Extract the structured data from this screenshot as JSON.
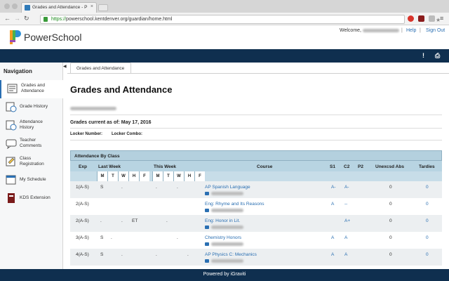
{
  "browser": {
    "tab_title": "Grades and Attendance - P",
    "tab_close": "×",
    "url_scheme": "https://",
    "url_rest": "powerschool.kentdenver.org/guardian/home.html",
    "star_icon": "★"
  },
  "header": {
    "logo_text": "PowerSchool",
    "welcome": "Welcome,",
    "separator": "|",
    "help": "Help",
    "sign_out": "Sign Out"
  },
  "sidebar": {
    "title": "Navigation",
    "items": [
      {
        "label1": "Grades and",
        "label2": "Attendance",
        "icon": "grades-icon"
      },
      {
        "label1": "Grade History",
        "label2": "",
        "icon": "grade-history-icon"
      },
      {
        "label1": "Attendance",
        "label2": "History",
        "icon": "attendance-history-icon"
      },
      {
        "label1": "Teacher",
        "label2": "Comments",
        "icon": "teacher-comments-icon"
      },
      {
        "label1": "Class",
        "label2": "Registration",
        "icon": "class-registration-icon"
      },
      {
        "label1": "My Schedule",
        "label2": "",
        "icon": "schedule-icon"
      },
      {
        "label1": "KDS Extension",
        "label2": "",
        "icon": "kds-extension-icon"
      }
    ]
  },
  "content": {
    "tab": "Grades and Attendance",
    "title": "Grades and Attendance",
    "current_as_of": "Grades current as of: May 17, 2016",
    "locker_number": "Locker Number:",
    "locker_combo": "Locker Combo:"
  },
  "table": {
    "caption": "Attendance By Class",
    "headers": {
      "exp": "Exp",
      "last_week": "Last Week",
      "this_week": "This Week",
      "course": "Course",
      "s1": "S1",
      "c2": "C2",
      "p2": "P2",
      "unexcused": "Unexcsd Abs",
      "tardies": "Tardies"
    },
    "days": [
      "M",
      "T",
      "W",
      "H",
      "F"
    ],
    "rows": [
      {
        "exp": "1(A-S)",
        "last": [
          "S",
          "",
          ".",
          "",
          ""
        ],
        "this": [
          ".",
          "",
          ".",
          "",
          ""
        ],
        "course": "AP Spanish Language",
        "s1": "A-",
        "c2": "A-",
        "p2": "",
        "abs": "0",
        "tardies": "0"
      },
      {
        "exp": "2(A-S)",
        "last": [
          "",
          "",
          "",
          "",
          ""
        ],
        "this": [
          "",
          "",
          "",
          "",
          ""
        ],
        "course": "Eng: Rhyme and Its Reasons",
        "s1": "A",
        "c2": "--",
        "p2": "",
        "abs": "0",
        "tardies": "0"
      },
      {
        "exp": "2(A-S)",
        "last": [
          ".",
          "",
          ".",
          "ET",
          ""
        ],
        "this": [
          "",
          ".",
          "",
          "",
          ""
        ],
        "course": "Eng: Honor in Lit.",
        "s1": "",
        "c2": "A+",
        "p2": "",
        "abs": "0",
        "tardies": "0"
      },
      {
        "exp": "3(A-S)",
        "last": [
          "S",
          ".",
          "",
          "",
          ""
        ],
        "this": [
          "",
          "",
          ".",
          "",
          ""
        ],
        "course": "Chemistry Honors",
        "s1": "A",
        "c2": "A",
        "p2": "",
        "abs": "0",
        "tardies": "0"
      },
      {
        "exp": "4(A-S)",
        "last": [
          "S",
          "",
          ".",
          "",
          ""
        ],
        "this": [
          ".",
          "",
          "",
          ".",
          ""
        ],
        "course": "AP Physics C: Mechanics",
        "s1": "A",
        "c2": "A",
        "p2": "",
        "abs": "0",
        "tardies": "0"
      }
    ]
  },
  "footer": {
    "text": "Powered by iGraviti"
  },
  "colors": {
    "navy": "#0f2f4f",
    "link": "#2a6fb2",
    "table_header": "#b8d4e2"
  }
}
